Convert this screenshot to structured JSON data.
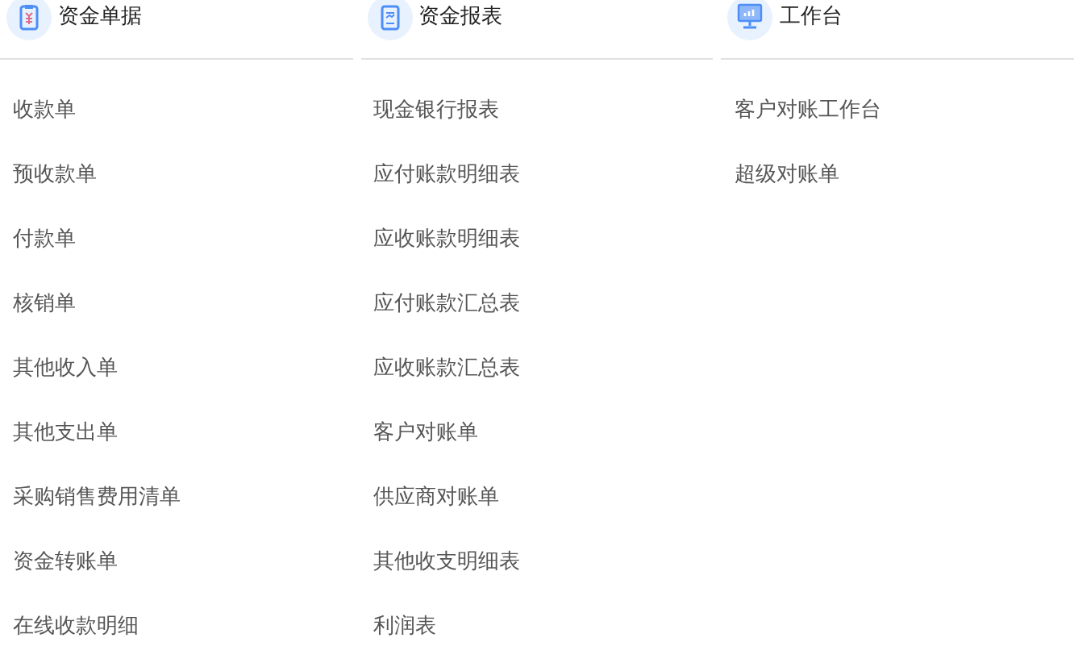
{
  "columns": [
    {
      "title": "资金单据",
      "kind": "documents",
      "items": [
        "收款单",
        "预收款单",
        "付款单",
        "核销单",
        "其他收入单",
        "其他支出单",
        "采购销售费用清单",
        "资金转账单",
        "在线收款明细"
      ]
    },
    {
      "title": "资金报表",
      "kind": "reports",
      "items": [
        "现金银行报表",
        "应付账款明细表",
        "应收账款明细表",
        "应付账款汇总表",
        "应收账款汇总表",
        "客户对账单",
        "供应商对账单",
        "其他收支明细表",
        "利润表"
      ]
    },
    {
      "title": "工作台",
      "kind": "workbench",
      "items": [
        "客户对账工作台",
        "超级对账单"
      ]
    }
  ]
}
